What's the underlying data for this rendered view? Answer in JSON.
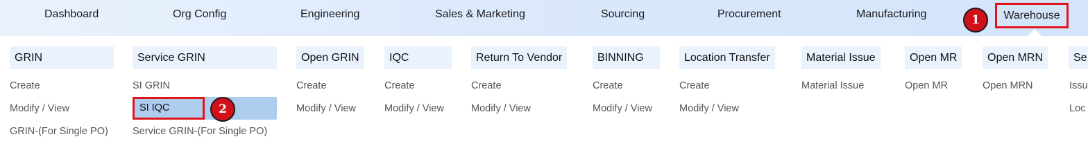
{
  "nav": {
    "items": [
      "Dashboard",
      "Org Config",
      "Engineering",
      "Sales & Marketing",
      "Sourcing",
      "Procurement",
      "Manufacturing"
    ],
    "active": "Warehouse"
  },
  "badges": [
    "1",
    "2"
  ],
  "menu": {
    "columns": [
      {
        "head": "GRIN",
        "links": [
          "Create",
          "Modify / View",
          "GRIN-(For Single PO)"
        ]
      },
      {
        "head": "Service GRIN",
        "links": [
          "SI GRIN",
          "SI IQC",
          "Service GRIN-(For Single PO)"
        ]
      },
      {
        "head": "Open GRIN",
        "links": [
          "Create",
          "Modify / View"
        ]
      },
      {
        "head": "IQC",
        "links": [
          "Create",
          "Modify / View"
        ]
      },
      {
        "head": "Return To Vendor",
        "links": [
          "Create",
          "Modify / View"
        ]
      },
      {
        "head": "BINNING",
        "links": [
          "Create",
          "Modify / View"
        ]
      },
      {
        "head": "Location Transfer",
        "links": [
          "Create",
          "Modify / View"
        ]
      },
      {
        "head": "Material Issue",
        "links": [
          "Material Issue"
        ]
      },
      {
        "head": "Open MR",
        "links": [
          "Open MR"
        ]
      },
      {
        "head": "Open MRN",
        "links": [
          "Open MRN"
        ]
      },
      {
        "head": "Se",
        "links": [
          "Issu",
          "Loc"
        ]
      }
    ]
  },
  "colors": {
    "highlight_border": "#e0141b",
    "badge_fill": "#d0101a",
    "selected_item_bg": "#aecdee",
    "nav_bg": "#dce9fb"
  }
}
